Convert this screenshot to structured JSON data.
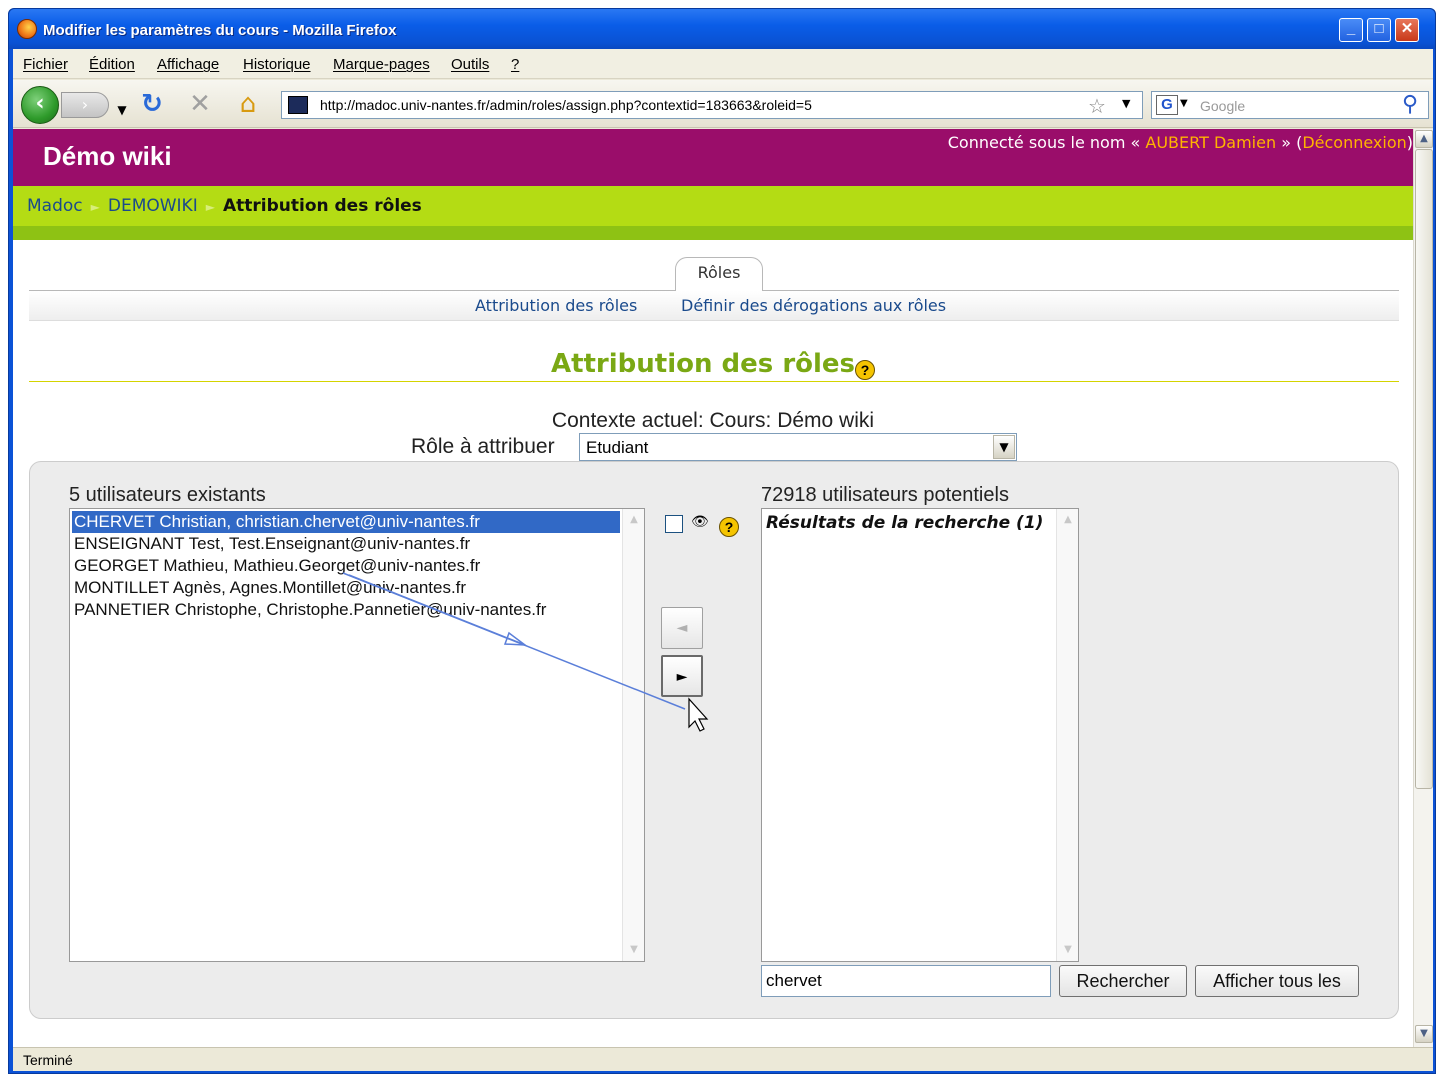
{
  "window": {
    "title": "Modifier les paramètres du cours - Mozilla Firefox"
  },
  "menu": [
    "Fichier",
    "Édition",
    "Affichage",
    "Historique",
    "Marque-pages",
    "Outils",
    "?"
  ],
  "navigation": {
    "url": "http://madoc.univ-nantes.fr/admin/roles/assign.php?contextid=183663&roleid=5",
    "search_placeholder": "Google"
  },
  "site": {
    "title": "Démo wiki",
    "login_prefix": "Connecté sous le nom «",
    "login_user": "AUBERT Damien",
    "login_mid": "» (",
    "logout": "Déconnexion",
    "login_suffix": ")"
  },
  "breadcrumb": [
    "Madoc",
    "DEMOWIKI",
    "Attribution des rôles"
  ],
  "tabs": {
    "main": "Rôles",
    "sub": [
      "Attribution des rôles",
      "Définir des dérogations aux rôles"
    ]
  },
  "heading": "Attribution des rôles",
  "context": "Contexte actuel: Cours: Démo wiki",
  "role": {
    "label": "Rôle à attribuer",
    "selected": "Etudiant"
  },
  "existing": {
    "title": "5 utilisateurs existants",
    "users": [
      "CHERVET Christian, christian.chervet@univ-nantes.fr",
      "ENSEIGNANT Test, Test.Enseignant@univ-nantes.fr",
      "GEORGET Mathieu, Mathieu.Georget@univ-nantes.fr",
      "MONTILLET Agnès, Agnes.Montillet@univ-nantes.fr",
      "PANNETIER Christophe, Christophe.Pannetier@univ-nantes.fr"
    ],
    "selected_index": 0
  },
  "potential": {
    "title": "72918 utilisateurs potentiels",
    "group_label": "Résultats de la recherche (1)"
  },
  "search": {
    "value": "chervet",
    "search_button": "Rechercher",
    "showall_button": "Afficher tous les"
  },
  "buttons": {
    "remove_glyph": "◄",
    "add_glyph": "►"
  },
  "status": "Terminé",
  "colors": {
    "header": "#9a0d6a",
    "breadcrumb": "#b4dc14",
    "accent_heading": "#7aa814",
    "link": "#1a4a8c",
    "login_link": "#ffb400"
  }
}
